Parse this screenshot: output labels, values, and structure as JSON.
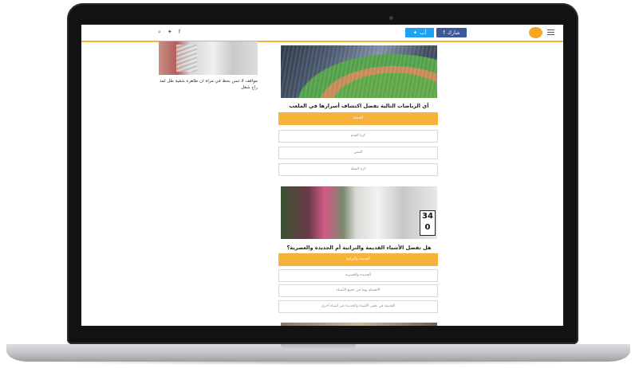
{
  "topbar": {
    "social": [
      "⌕",
      "🐦",
      "f"
    ],
    "share_facebook": "شارك",
    "share_twitter": "أب"
  },
  "side_article": {
    "title": "مواقف لا تنس بحظ في مراة ان ظاهرة شقية طل لمد راح شغل"
  },
  "quizzes": [
    {
      "question": "أي الرياضات التالية تفضل اكتشاف أسرارها في الملعب",
      "options": [
        "الجملة",
        "كرة القدم",
        "التنس",
        "كرة السلة"
      ]
    },
    {
      "question": "هل تفضل الأشياء القديمة والتراثية أم الجديدة والعصرية؟",
      "options": [
        "القديمة والتراثية",
        "الجديدة والعصرية",
        "الاهتمام بهما في جميع الأشياء",
        "القديمة في بعض الأشياء والجديدة في أشياء أخرى"
      ]
    }
  ],
  "beetle_plate": "34\n0",
  "colors": {
    "accent": "#f6b23c",
    "facebook": "#3b5998",
    "twitter": "#1da1f2"
  }
}
